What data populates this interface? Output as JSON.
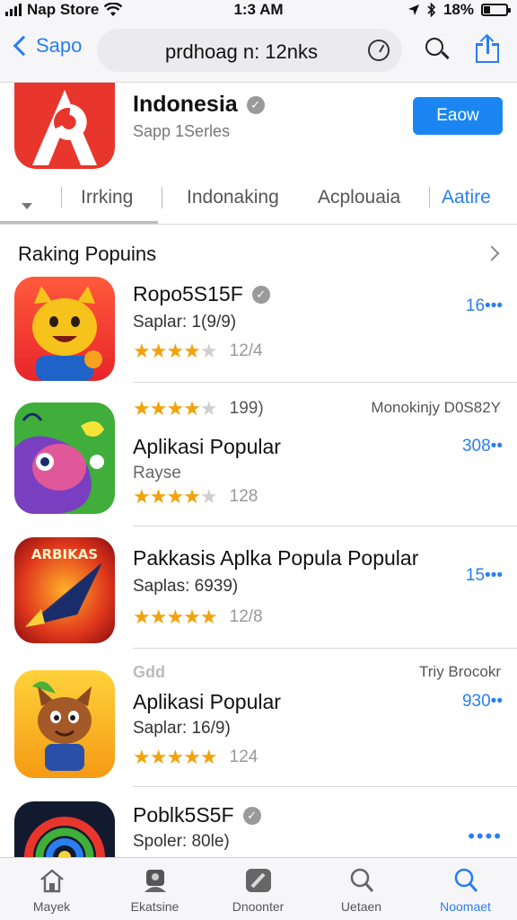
{
  "status_bar": {
    "carrier": "Nap Store",
    "time": "1:3 AM",
    "battery_text": "18%"
  },
  "nav": {
    "back_label": "Sapo",
    "search_text": "prdhoag n: 12nks"
  },
  "header_app": {
    "title": "Indonesia",
    "subtitle": "Sapp 1Serles",
    "get_label": "Eaow"
  },
  "tabs": [
    {
      "label": "Irrking"
    },
    {
      "label": "Indonaking"
    },
    {
      "label": "Acplouaia"
    },
    {
      "label": "Aatire"
    }
  ],
  "section": {
    "title": "Raking Popuins"
  },
  "apps": [
    {
      "name": "Ropo5S15F",
      "subtitle": "Saplar: 1(9/9)",
      "rating": 4.5,
      "stars": "★★★★★",
      "star_count": "12/4",
      "price": "16•••"
    },
    {
      "top_stars": "★★★★",
      "top_count": "199)",
      "right_note": "Monokinjy D0S82Y",
      "name": "Aplikasi Popular",
      "subtitle": "Rayse",
      "rating": 4.5,
      "stars": "★★★★★",
      "star_count": "128",
      "price": "308••"
    },
    {
      "name": "Pakkasis Aplka Popula Popular",
      "subtitle": "Saplas: 6939)",
      "rating": 4.5,
      "stars": "★★★★★",
      "star_count": "12/8",
      "price": "15•••",
      "icon_text": "ARBIKAS"
    },
    {
      "tag": "Gdd",
      "right_note": "Triy Brocokr",
      "name": "Aplikasi Popular",
      "subtitle": "Saplar: 16/9)",
      "rating": 5,
      "stars": "★★★★★",
      "star_count": "124",
      "price": "930••"
    },
    {
      "name": "Poblk5S5F",
      "subtitle": "Spoler: 80le)",
      "price": "••••"
    }
  ],
  "tab_bar": [
    {
      "label": "Mayek",
      "icon": "house-icon"
    },
    {
      "label": "Ekatsine",
      "icon": "person-icon"
    },
    {
      "label": "Dnoonter",
      "icon": "pencil-icon"
    },
    {
      "label": "Uetaen",
      "icon": "search-icon"
    },
    {
      "label": "Noomaet",
      "icon": "search-icon",
      "active": true
    }
  ],
  "colors": {
    "accent": "#2a7ef0",
    "star": "#f2a20c",
    "get_button": "#1b86f2"
  }
}
